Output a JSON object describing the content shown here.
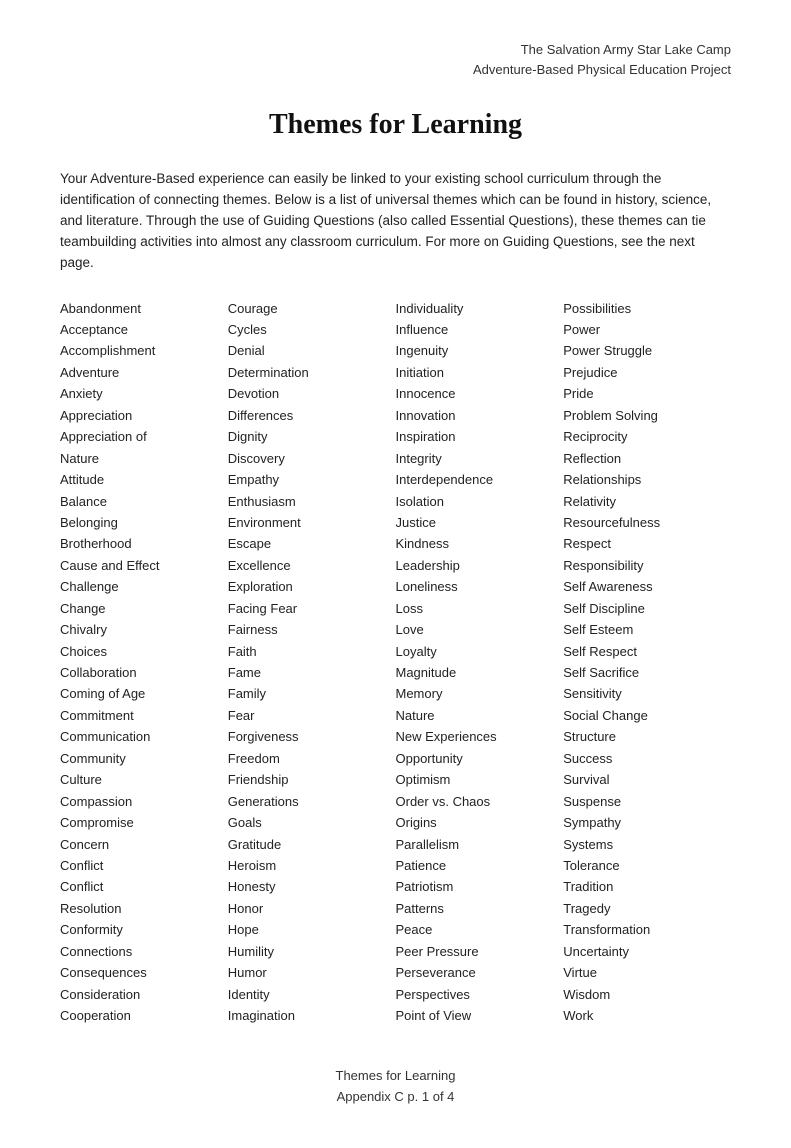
{
  "header": {
    "line1": "The Salvation Army Star Lake Camp",
    "line2": "Adventure-Based Physical Education Project"
  },
  "title": "Themes for Learning",
  "intro": "Your Adventure-Based experience can easily be linked to your existing school curriculum through the identification of connecting themes. Below is a list of universal themes which can be found in history, science, and literature. Through the use of Guiding Questions (also called Essential Questions), these themes can tie teambuilding activities into almost any classroom curriculum. For more on Guiding Questions, see the next page.",
  "columns": [
    [
      "Abandonment",
      "Acceptance",
      "Accomplishment",
      "Adventure",
      "Anxiety",
      "Appreciation",
      "Appreciation of",
      "Nature",
      "Attitude",
      "Balance",
      "Belonging",
      "Brotherhood",
      "Cause and Effect",
      "Challenge",
      "Change",
      "Chivalry",
      "Choices",
      "Collaboration",
      "Coming of Age",
      "Commitment",
      "Communication",
      "Community",
      "Culture",
      "Compassion",
      "Compromise",
      "Concern",
      "Conflict",
      "Conflict",
      "Resolution",
      "Conformity",
      "Connections",
      "Consequences",
      "Consideration",
      "Cooperation"
    ],
    [
      "Courage",
      "Cycles",
      "Denial",
      "Determination",
      "Devotion",
      "Differences",
      "Dignity",
      "Discovery",
      "Empathy",
      "Enthusiasm",
      "Environment",
      "Escape",
      "Excellence",
      "Exploration",
      "Facing Fear",
      "Fairness",
      "Faith",
      "Fame",
      "Family",
      "Fear",
      "Forgiveness",
      "Freedom",
      "Friendship",
      "Generations",
      "Goals",
      "Gratitude",
      "Heroism",
      "Honesty",
      "Honor",
      "Hope",
      "Humility",
      "Humor",
      "Identity",
      "Imagination"
    ],
    [
      "Individuality",
      "Influence",
      "Ingenuity",
      "Initiation",
      "Innocence",
      "Innovation",
      "Inspiration",
      "Integrity",
      "Interdependence",
      "Isolation",
      "Justice",
      "Kindness",
      "Leadership",
      "Loneliness",
      "Loss",
      "Love",
      "Loyalty",
      "Magnitude",
      "Memory",
      "Nature",
      "New Experiences",
      "Opportunity",
      "Optimism",
      "Order vs. Chaos",
      "Origins",
      "Parallelism",
      "Patience",
      "Patriotism",
      "Patterns",
      "Peace",
      "Peer Pressure",
      "Perseverance",
      "Perspectives",
      "Point of View"
    ],
    [
      "Possibilities",
      "Power",
      "Power Struggle",
      "Prejudice",
      "Pride",
      "Problem Solving",
      "Reciprocity",
      "Reflection",
      "Relationships",
      "Relativity",
      "Resourcefulness",
      "Respect",
      "Responsibility",
      "Self Awareness",
      "Self Discipline",
      "Self Esteem",
      "Self Respect",
      "Self Sacrifice",
      "Sensitivity",
      "Social Change",
      "Structure",
      "Success",
      "Survival",
      "Suspense",
      "Sympathy",
      "Systems",
      "Tolerance",
      "Tradition",
      "Tragedy",
      "Transformation",
      "Uncertainty",
      "Virtue",
      "Wisdom",
      "Work"
    ]
  ],
  "footer": {
    "line1": "Themes for Learning",
    "line2": "Appendix C p. 1 of 4"
  }
}
